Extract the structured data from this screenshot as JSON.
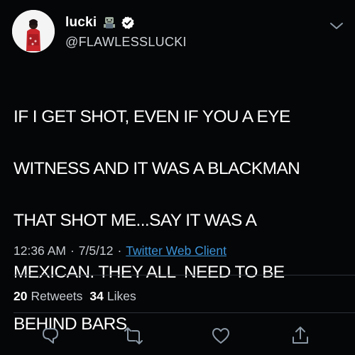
{
  "user": {
    "display_name": "lucki",
    "handle": "@FLAWLESSLUCKI",
    "verified": true,
    "name_emoji": "zombie-emoji"
  },
  "tweet": {
    "text_lines": [
      "IF I GET SHOT, EVEN IF YOU A EYE",
      "WITNESS AND IT WAS A BLACKMAN",
      "THAT SHOT ME...SAY IT WAS A",
      "MEXICAN. THEY ALL  NEED TO BE",
      "BEHIND BARS"
    ],
    "time": "12:36 AM",
    "date": "7/5/12",
    "separator": "·",
    "source": "Twitter Web Client"
  },
  "stats": {
    "retweets_count": "20",
    "retweets_label": "Retweets",
    "likes_count": "34",
    "likes_label": "Likes"
  },
  "actions": {
    "icons": [
      "reply-icon",
      "retweet-icon",
      "like-icon",
      "share-icon"
    ]
  },
  "colors": {
    "background": "#050608",
    "text": "#ffffff",
    "secondary_text": "#c7ccd1",
    "link": "#3b94d9",
    "icon": "#8b98a5",
    "divider": "#2c3036"
  }
}
